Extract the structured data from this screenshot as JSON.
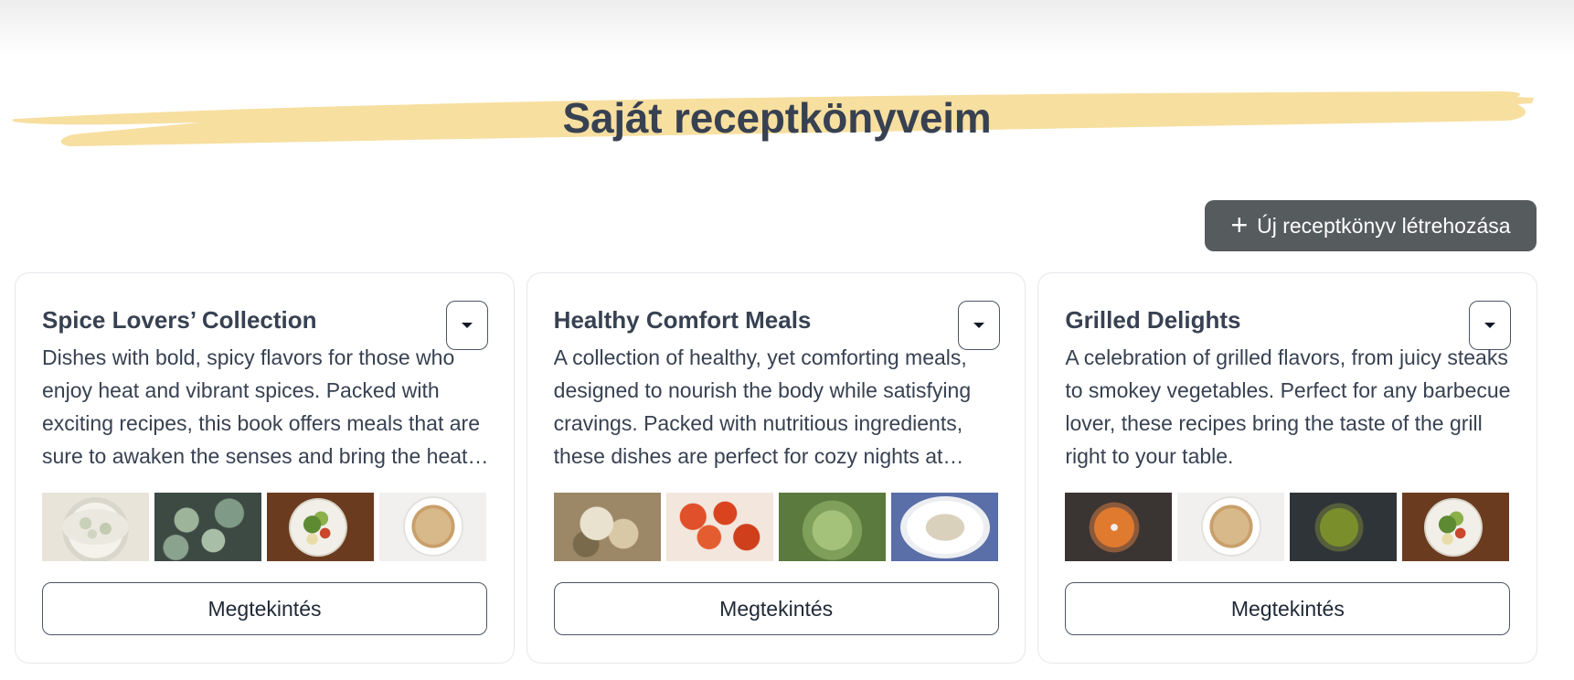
{
  "page": {
    "title": "Saját receptkönyveim",
    "highlight_color": "#f7dfa0"
  },
  "toolbar": {
    "create_label": "Új receptkönyv létrehozása",
    "create_icon": "plus-icon"
  },
  "cookbooks": [
    {
      "title": "Spice Lovers’ Collection",
      "description": "Dishes with bold, spicy flavors for those who enjoy heat and vibrant spices. Packed with exciting recipes, this book offers meals that are sure to awaken the senses and bring the heat to every bite.",
      "thumbnails": [
        "dumplings",
        "kale",
        "salad-bowl",
        "noodles"
      ],
      "view_label": "Megtekintés"
    },
    {
      "title": "Healthy Comfort Meals",
      "description": "A collection of healthy, yet comforting meals, designed to nourish the body while satisfying cravings. Packed with nutritious ingredients, these dishes are perfect for cozy nights at home.",
      "thumbnails": [
        "cheesy-dish",
        "sweet-sour-chicken",
        "green-curry",
        "risotto"
      ],
      "view_label": "Megtekintés"
    },
    {
      "title": "Grilled Delights",
      "description": "A celebration of grilled flavors, from juicy steaks to smokey vegetables. Perfect for any barbecue lover, these recipes bring the taste of the grill right to your table.",
      "thumbnails": [
        "butter-chicken",
        "noodles",
        "palak",
        "salad-bowl"
      ],
      "view_label": "Megtekintés"
    }
  ],
  "colors": {
    "primary_button": "#565b5e",
    "text": "#374151"
  }
}
